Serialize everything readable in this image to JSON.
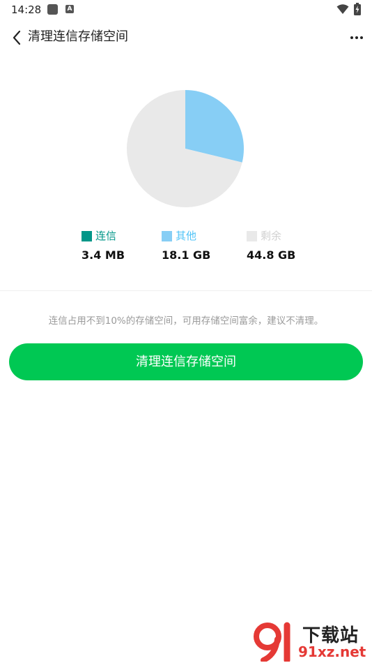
{
  "status_bar": {
    "time": "14:28"
  },
  "header": {
    "title": "清理连信存储空间"
  },
  "chart_data": {
    "type": "pie",
    "slices": [
      {
        "name": "连信",
        "value_label": "3.4 MB",
        "value_gb": 0.0034,
        "color": "#009688"
      },
      {
        "name": "其他",
        "value_label": "18.1 GB",
        "value_gb": 18.1,
        "color": "#87cef5"
      },
      {
        "name": "剩余",
        "value_label": "44.8 GB",
        "value_gb": 44.8,
        "color": "#e9e9e9"
      }
    ],
    "legend_placement": "bottom"
  },
  "legend_colors": {
    "lianxin_text": "#009688",
    "other_text": "#4fc3f7",
    "remaining_text": "#d0d0d0"
  },
  "tip": {
    "text": "连信占用不到10%的存储空间，可用存储空间富余，建议不清理。"
  },
  "actions": {
    "clean_label": "清理连信存储空间"
  },
  "watermark": {
    "title": "下载站",
    "url": "91xz.net"
  }
}
